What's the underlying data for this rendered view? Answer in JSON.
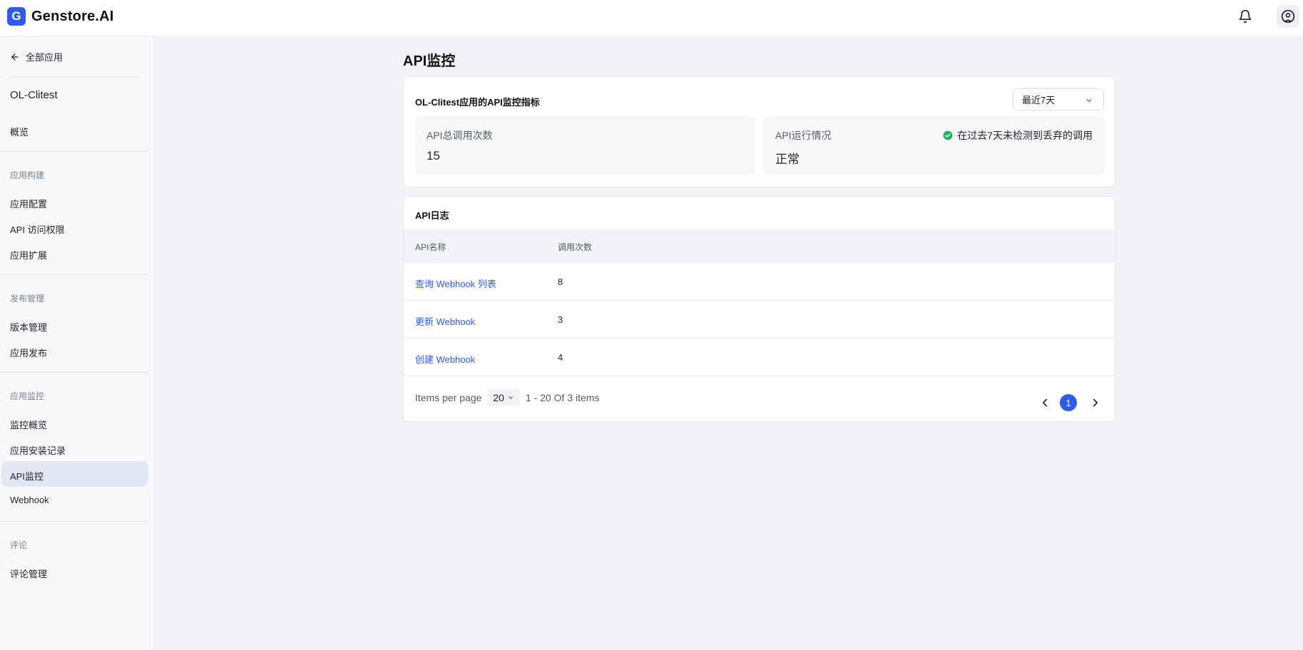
{
  "app": {
    "brand": "Genstore.AI",
    "brand_initial": "G"
  },
  "header": {
    "icons": [
      "bell-icon",
      "user-circle-icon"
    ]
  },
  "sidebar": {
    "back_label": "全部应用",
    "app_name": "OL-Clitest",
    "overview": "概览",
    "groups": [
      {
        "title": "应用构建",
        "items": [
          "应用配置",
          "API 访问权限",
          "应用扩展"
        ]
      },
      {
        "title": "发布管理",
        "items": [
          "版本管理",
          "应用发布"
        ]
      },
      {
        "title": "应用监控",
        "items": [
          "监控概览",
          "应用安装记录",
          "API监控",
          "Webhook"
        ]
      },
      {
        "title": "评论",
        "items": [
          "评论管理"
        ]
      }
    ],
    "active_item": "API监控"
  },
  "main": {
    "title": "API监控",
    "metrics": {
      "title": "OL-Clitest应用的API监控指标",
      "range": "最近7天",
      "total_label": "API总调用次数",
      "total_value": "15",
      "status_label": "API运行情况",
      "status_value": "正常",
      "status_note": "在过去7天未检测到丢弃的调用"
    },
    "logs": {
      "title": "API日志",
      "columns": [
        "API名称",
        "调用次数"
      ],
      "rows": [
        {
          "name": "查询 Webhook 列表",
          "count": "8"
        },
        {
          "name": "更新 Webhook",
          "count": "3"
        },
        {
          "name": "创建 Webhook",
          "count": "4"
        }
      ],
      "pagination": {
        "items_per_page_label": "Items per page",
        "page_size": "20",
        "range_text": "1 - 20 Of 3 items",
        "current_page": "1"
      }
    }
  },
  "colors": {
    "accent": "#2f5af0",
    "success": "#22b457",
    "active_bg": "#e3e7f3"
  }
}
